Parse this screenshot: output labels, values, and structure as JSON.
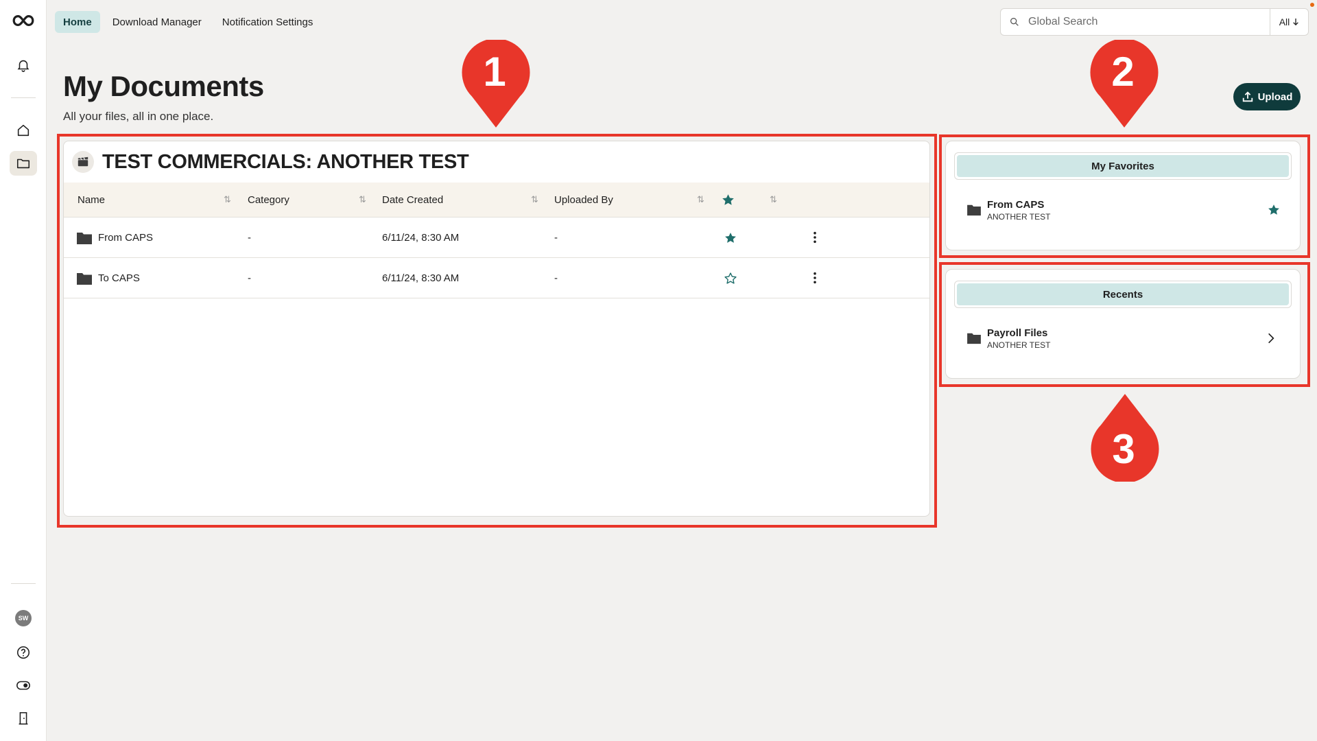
{
  "nav": {
    "tabs": [
      {
        "label": "Home",
        "active": true
      },
      {
        "label": "Download Manager",
        "active": false
      },
      {
        "label": "Notification Settings",
        "active": false
      }
    ]
  },
  "search": {
    "placeholder": "Global Search",
    "filter_label": "All"
  },
  "sidebar": {
    "avatar_initials": "SW"
  },
  "header": {
    "title": "My Documents",
    "subtitle": "All your files, all in one place.",
    "upload_label": "Upload"
  },
  "documents": {
    "title": "TEST COMMERCIALS: ANOTHER TEST",
    "columns": [
      "Name",
      "Category",
      "Date Created",
      "Uploaded By"
    ],
    "rows": [
      {
        "name": "From CAPS",
        "category": "-",
        "date": "6/11/24, 8:30 AM",
        "uploaded_by": "-",
        "favorite": true
      },
      {
        "name": "To CAPS",
        "category": "-",
        "date": "6/11/24, 8:30 AM",
        "uploaded_by": "-",
        "favorite": false
      }
    ]
  },
  "favorites": {
    "title": "My Favorites",
    "items": [
      {
        "name": "From CAPS",
        "sub": "ANOTHER TEST"
      }
    ]
  },
  "recents": {
    "title": "Recents",
    "items": [
      {
        "name": "Payroll Files",
        "sub": "ANOTHER TEST"
      }
    ]
  },
  "annotations": [
    {
      "number": "1"
    },
    {
      "number": "2"
    },
    {
      "number": "3"
    }
  ],
  "colors": {
    "accent_dark": "#0f3b3c",
    "accent_light": "#cfe7e6",
    "star": "#1f6e6b",
    "annotation": "#e8362a",
    "folder": "#3e3e3e"
  }
}
